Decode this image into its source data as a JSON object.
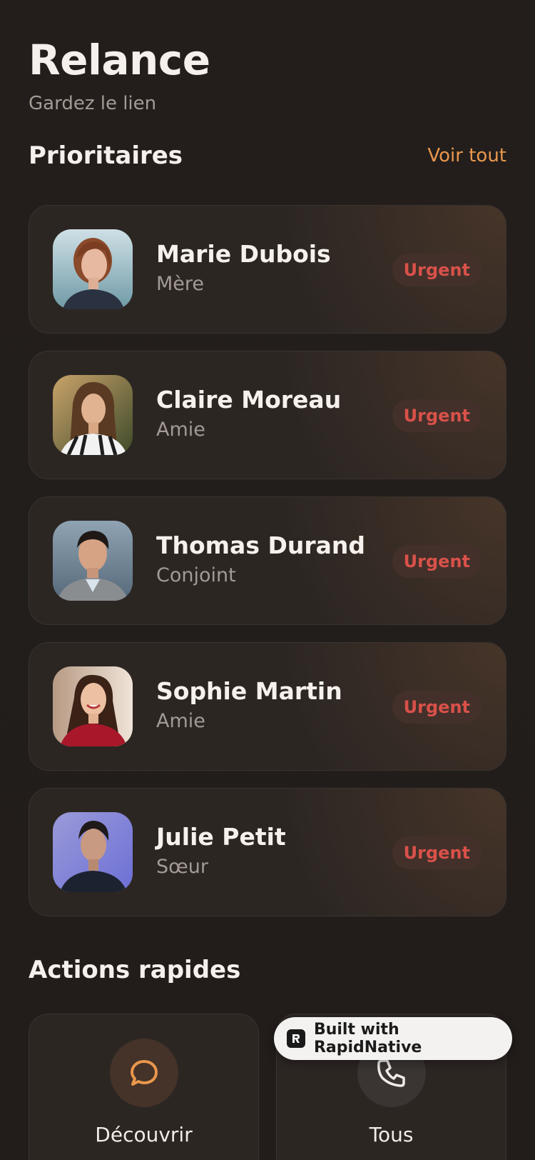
{
  "header": {
    "title": "Relance",
    "subtitle": "Gardez le lien"
  },
  "priority": {
    "title": "Prioritaires",
    "see_all": "Voir tout",
    "contacts": [
      {
        "name": "Marie Dubois",
        "relation": "Mère",
        "badge": "Urgent"
      },
      {
        "name": "Claire Moreau",
        "relation": "Amie",
        "badge": "Urgent"
      },
      {
        "name": "Thomas Durand",
        "relation": "Conjoint",
        "badge": "Urgent"
      },
      {
        "name": "Sophie Martin",
        "relation": "Amie",
        "badge": "Urgent"
      },
      {
        "name": "Julie Petit",
        "relation": "Sœur",
        "badge": "Urgent"
      }
    ]
  },
  "quick_actions": {
    "title": "Actions rapides",
    "items": [
      {
        "label": "Découvrir",
        "icon": "chat-bubble-icon"
      },
      {
        "label": "Tous",
        "icon": "phone-icon"
      }
    ]
  },
  "builder_badge": {
    "label": "Built with RapidNative",
    "icon": "rapidnative-logo-icon"
  },
  "colors": {
    "background": "#221e1c",
    "card": "#2c2623",
    "accent": "#e9974d",
    "urgent_text": "#d8514a",
    "urgent_bg": "#43302a"
  }
}
